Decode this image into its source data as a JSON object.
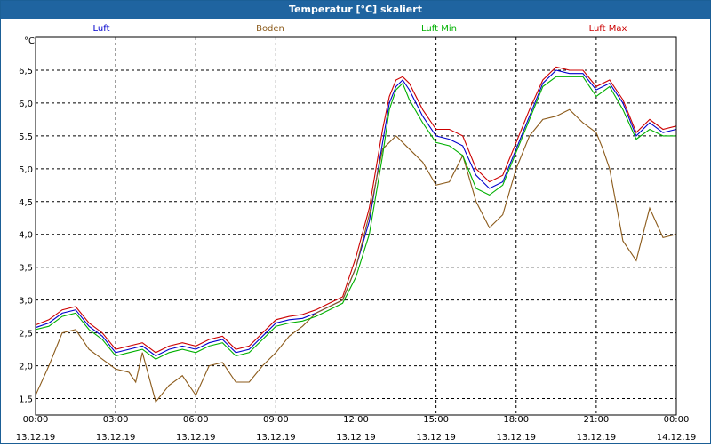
{
  "window": {
    "title": "Temperatur [°C] skaliert"
  },
  "chart_data": {
    "type": "line",
    "title": "Temperatur [°C] skaliert",
    "ylabel": "°C",
    "ylim": [
      1.25,
      7.0
    ],
    "xlim": [
      0,
      24
    ],
    "grid": true,
    "legend_placement": "top",
    "y_ticks": [
      "1,5",
      "2,0",
      "2,5",
      "3,0",
      "3,5",
      "4,0",
      "4,5",
      "5,0",
      "5,5",
      "6,0",
      "6,5"
    ],
    "x_ticks": [
      {
        "time": "00:00",
        "date": "13.12.19"
      },
      {
        "time": "03:00",
        "date": "13.12.19"
      },
      {
        "time": "06:00",
        "date": "13.12.19"
      },
      {
        "time": "09:00",
        "date": "13.12.19"
      },
      {
        "time": "12:00",
        "date": "13.12.19"
      },
      {
        "time": "15:00",
        "date": "13.12.19"
      },
      {
        "time": "18:00",
        "date": "13.12.19"
      },
      {
        "time": "21:00",
        "date": "13.12.19"
      },
      {
        "time": "00:00",
        "date": "14.12.19"
      }
    ],
    "series": [
      {
        "name": "Luft",
        "color": "#0000cc",
        "x": [
          0,
          0.5,
          1,
          1.5,
          2,
          2.5,
          3,
          3.5,
          4,
          4.5,
          5,
          5.5,
          6,
          6.5,
          7,
          7.5,
          8,
          8.5,
          9,
          9.5,
          10,
          10.5,
          11,
          11.5,
          12,
          12.5,
          13,
          13.25,
          13.5,
          13.75,
          14,
          14.5,
          15,
          15.5,
          16,
          16.5,
          17,
          17.5,
          18,
          18.5,
          19,
          19.5,
          20,
          20.5,
          21,
          21.5,
          22,
          22.5,
          23,
          23.5,
          24
        ],
        "y": [
          2.58,
          2.65,
          2.8,
          2.85,
          2.6,
          2.45,
          2.2,
          2.25,
          2.3,
          2.15,
          2.25,
          2.3,
          2.25,
          2.35,
          2.4,
          2.2,
          2.25,
          2.45,
          2.65,
          2.7,
          2.72,
          2.8,
          2.9,
          3.0,
          3.5,
          4.2,
          5.4,
          6.0,
          6.25,
          6.35,
          6.2,
          5.8,
          5.5,
          5.45,
          5.35,
          4.9,
          4.7,
          4.8,
          5.3,
          5.8,
          6.3,
          6.5,
          6.45,
          6.45,
          6.2,
          6.3,
          6.0,
          5.5,
          5.7,
          5.55,
          5.6
        ]
      },
      {
        "name": "Boden",
        "color": "#8b5a1a",
        "x": [
          0,
          0.5,
          1,
          1.5,
          2,
          2.5,
          3,
          3.5,
          3.75,
          4,
          4.5,
          5,
          5.5,
          6,
          6.5,
          7,
          7.5,
          8,
          8.5,
          9,
          9.5,
          10,
          10.5,
          11,
          11.5,
          12,
          12.5,
          13,
          13.5,
          14,
          14.5,
          15,
          15.5,
          16,
          16.5,
          17,
          17.5,
          18,
          18.5,
          19,
          19.5,
          20,
          20.5,
          21,
          21.25,
          21.5,
          22,
          22.5,
          23,
          23.5,
          24
        ],
        "y": [
          1.55,
          2.0,
          2.5,
          2.55,
          2.25,
          2.1,
          1.95,
          1.9,
          1.75,
          2.2,
          1.45,
          1.7,
          1.85,
          1.55,
          2.0,
          2.05,
          1.75,
          1.75,
          2.0,
          2.2,
          2.45,
          2.6,
          2.8,
          2.9,
          3.0,
          3.5,
          4.3,
          5.3,
          5.5,
          5.3,
          5.1,
          4.75,
          4.8,
          5.2,
          4.5,
          4.1,
          4.3,
          5.0,
          5.5,
          5.75,
          5.8,
          5.9,
          5.7,
          5.55,
          5.3,
          5.0,
          3.9,
          3.6,
          4.4,
          3.95,
          4.0
        ]
      },
      {
        "name": "Luft Min",
        "color": "#00b000",
        "x": [
          0,
          0.5,
          1,
          1.5,
          2,
          2.5,
          3,
          3.5,
          4,
          4.5,
          5,
          5.5,
          6,
          6.5,
          7,
          7.5,
          8,
          8.5,
          9,
          9.5,
          10,
          10.5,
          11,
          11.5,
          12,
          12.5,
          13,
          13.25,
          13.5,
          13.75,
          14,
          14.5,
          15,
          15.5,
          16,
          16.5,
          17,
          17.5,
          18,
          18.5,
          19,
          19.5,
          20,
          20.5,
          21,
          21.5,
          22,
          22.5,
          23,
          23.5,
          24
        ],
        "y": [
          2.55,
          2.6,
          2.75,
          2.8,
          2.55,
          2.4,
          2.15,
          2.2,
          2.25,
          2.1,
          2.2,
          2.25,
          2.2,
          2.3,
          2.35,
          2.15,
          2.2,
          2.4,
          2.6,
          2.65,
          2.68,
          2.75,
          2.85,
          2.95,
          3.35,
          4.0,
          5.2,
          5.9,
          6.2,
          6.3,
          6.05,
          5.7,
          5.4,
          5.35,
          5.2,
          4.7,
          4.6,
          4.75,
          5.25,
          5.75,
          6.25,
          6.4,
          6.4,
          6.4,
          6.1,
          6.25,
          5.9,
          5.45,
          5.6,
          5.5,
          5.5
        ]
      },
      {
        "name": "Luft Max",
        "color": "#cc0000",
        "x": [
          0,
          0.5,
          1,
          1.5,
          2,
          2.5,
          3,
          3.5,
          4,
          4.5,
          5,
          5.5,
          6,
          6.5,
          7,
          7.5,
          8,
          8.5,
          9,
          9.5,
          10,
          10.5,
          11,
          11.5,
          12,
          12.5,
          13,
          13.25,
          13.5,
          13.75,
          14,
          14.5,
          15,
          15.5,
          16,
          16.5,
          17,
          17.5,
          18,
          18.5,
          19,
          19.5,
          20,
          20.5,
          21,
          21.5,
          22,
          22.5,
          23,
          23.5,
          24
        ],
        "y": [
          2.62,
          2.7,
          2.85,
          2.9,
          2.65,
          2.5,
          2.25,
          2.3,
          2.35,
          2.2,
          2.3,
          2.35,
          2.3,
          2.4,
          2.45,
          2.25,
          2.3,
          2.5,
          2.7,
          2.75,
          2.78,
          2.85,
          2.95,
          3.05,
          3.65,
          4.4,
          5.6,
          6.1,
          6.35,
          6.4,
          6.3,
          5.9,
          5.6,
          5.6,
          5.5,
          5.0,
          4.8,
          4.9,
          5.4,
          5.9,
          6.35,
          6.55,
          6.5,
          6.5,
          6.25,
          6.35,
          6.05,
          5.55,
          5.75,
          5.6,
          5.65
        ]
      }
    ]
  }
}
